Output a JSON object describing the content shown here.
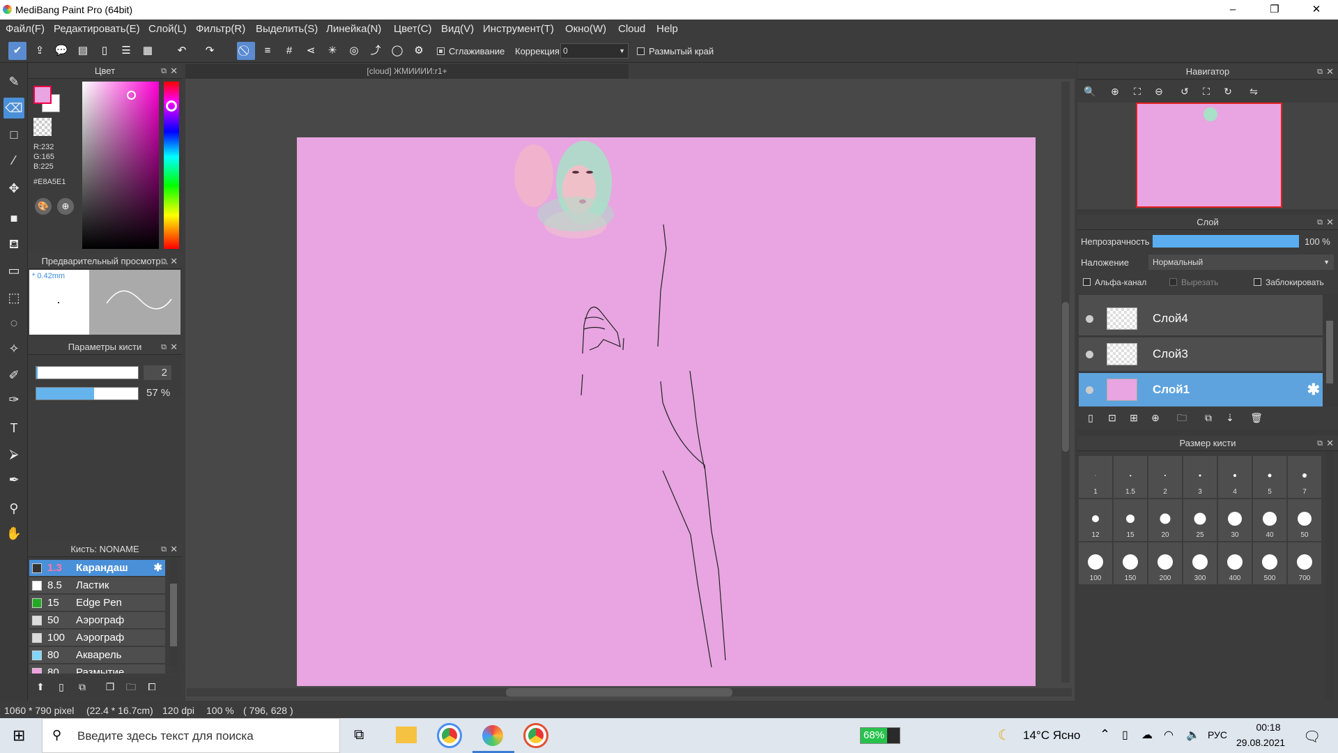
{
  "window": {
    "title": "MediBang Paint Pro (64bit)",
    "min": "–",
    "max": "❐",
    "close": "✕"
  },
  "menu": [
    "Файл(F)",
    "Редактировать(E)",
    "Слой(L)",
    "Фильтр(R)",
    "Выделить(S)",
    "Линейка(N)",
    "Цвет(C)",
    "Вид(V)",
    "Инструмент(T)",
    "Окно(W)",
    "Cloud",
    "Help"
  ],
  "toolbar": {
    "smoothing_label": "Сглаживание",
    "correction_label": "Коррекция",
    "correction_value": "0",
    "blur_edge_label": "Размытый край"
  },
  "color_panel": {
    "title": "Цвет",
    "r": "R:232",
    "g": "G:165",
    "b": "B:225",
    "hex": "#E8A5E1",
    "fg_color": "#E8A5E1"
  },
  "preview_panel": {
    "title": "Предварительный просмотр...",
    "size": "* 0.42mm"
  },
  "brush_params": {
    "title": "Параметры кисти",
    "size_value": "2",
    "opacity_value": "57 %",
    "opacity_fraction": 0.57
  },
  "brush_list": {
    "title": "Кисть: NONAME",
    "items": [
      {
        "size": "1.3",
        "name": "Карандаш",
        "color": "#333333",
        "selected": true
      },
      {
        "size": "8.5",
        "name": "Ластик",
        "color": "#ffffff"
      },
      {
        "size": "15",
        "name": "Edge Pen",
        "color": "#22aa22"
      },
      {
        "size": "50",
        "name": "Аэрограф",
        "color": "#dddddd"
      },
      {
        "size": "100",
        "name": "Аэрограф",
        "color": "#dddddd"
      },
      {
        "size": "80",
        "name": "Акварель",
        "color": "#7fd7ff"
      },
      {
        "size": "80",
        "name": "Размытие",
        "color": "#f0a0e0"
      }
    ]
  },
  "document": {
    "tab": "[cloud] ЖМИИИИ:r1+",
    "bg_color": "#E8A5E1"
  },
  "navigator": {
    "title": "Навигатор"
  },
  "layer_panel": {
    "title": "Слой",
    "opacity_label": "Непрозрачность",
    "opacity_value": "100 %",
    "blend_label": "Наложение",
    "blend_value": "Нормальный",
    "alpha_label": "Альфа-канал",
    "clip_label": "Вырезать",
    "lock_label": "Заблокировать",
    "layers": [
      {
        "name": "Слой4",
        "selected": false
      },
      {
        "name": "Слой3",
        "selected": false
      },
      {
        "name": "Слой1",
        "selected": true
      }
    ]
  },
  "brush_size_panel": {
    "title": "Размер кисти",
    "sizes": [
      "1",
      "1.5",
      "2",
      "3",
      "4",
      "5",
      "7",
      "12",
      "15",
      "20",
      "25",
      "30",
      "40",
      "50",
      "100",
      "150",
      "200",
      "300",
      "400",
      "500",
      "700"
    ]
  },
  "status": {
    "pixels": "1060 * 790 pixel",
    "cm": "(22.4 * 16.7cm)",
    "dpi": "120 dpi",
    "zoom": "100 %",
    "coords": "( 796, 628 )"
  },
  "taskbar": {
    "search_placeholder": "Введите здесь текст для поиска",
    "battery": "68%",
    "weather": "14°C Ясно",
    "lang": "РУС",
    "time": "00:18",
    "date": "29.08.2021"
  }
}
